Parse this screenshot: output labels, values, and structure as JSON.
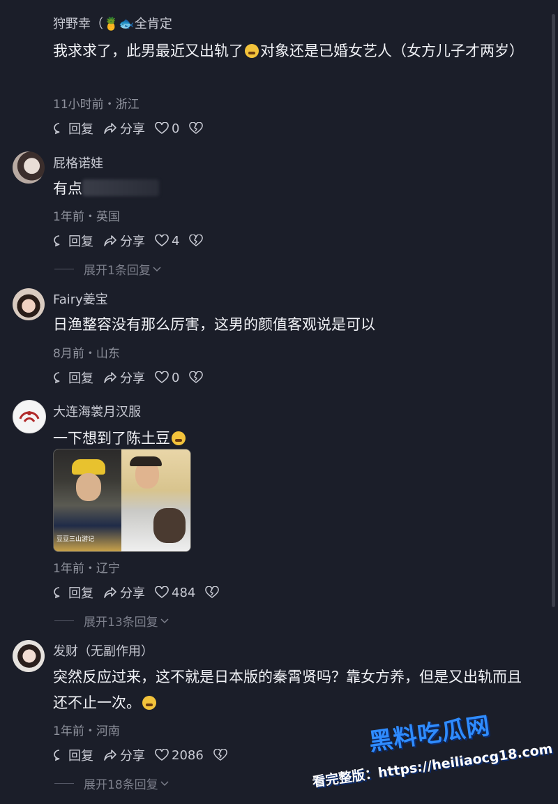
{
  "comments": [
    {
      "username": "狩野幸（🍍🐟全肯定",
      "text": "我求求了，此男最近又出轨了",
      "text_after": "对象还是已婚女艺人（女方儿子才两岁）",
      "meta": "11小时前・浙江",
      "reply": "回复",
      "share": "分享",
      "likes": "0"
    },
    {
      "username": "屁格诺娃",
      "text": "有点",
      "meta": "1年前・英国",
      "reply": "回复",
      "share": "分享",
      "likes": "4",
      "expand": "展开1条回复"
    },
    {
      "username": "Fairy姜宝",
      "text": "日渔整容没有那么厉害，这男的颜值客观说是可以",
      "meta": "8月前・山东",
      "reply": "回复",
      "share": "分享",
      "likes": "0"
    },
    {
      "username": "大连海裳月汉服",
      "text": "一下想到了陈土豆",
      "photo_caption": "豆豆三山游记",
      "meta": "1年前・辽宁",
      "reply": "回复",
      "share": "分享",
      "likes": "484",
      "expand": "展开13条回复"
    },
    {
      "username": "发财（无副作用）",
      "text": "突然反应过来，这不就是日本版的秦霄贤吗？靠女方养，但是又出轨而且还不止一次。",
      "meta": "1年前・河南",
      "reply": "回复",
      "share": "分享",
      "likes": "2086",
      "expand": "展开18条回复"
    }
  ],
  "watermark": {
    "brand": "黑料吃瓜网",
    "label": "看完整版：",
    "url": "https://heiliaocg18.com"
  },
  "colors": {
    "background": "#1b1e29",
    "watermark_blue": "#2f8cff"
  }
}
